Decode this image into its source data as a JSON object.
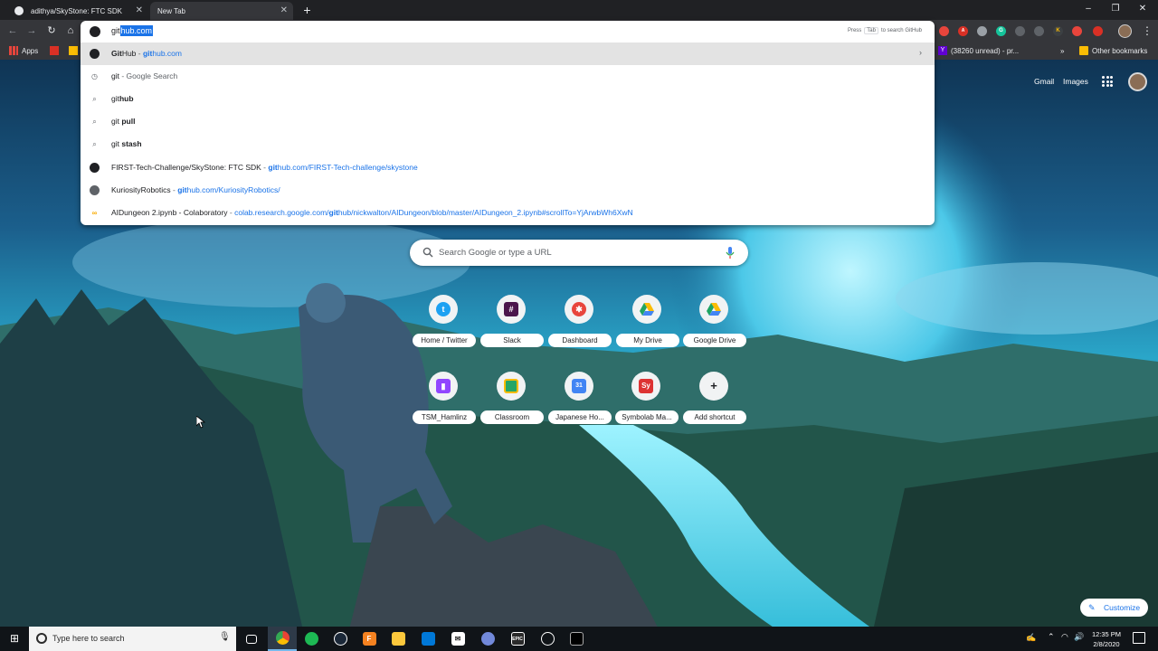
{
  "browser": {
    "tabs": [
      {
        "title": "adithya/SkyStone: FTC SDK",
        "active": false
      },
      {
        "title": "New Tab",
        "active": true
      }
    ],
    "window_controls": [
      "minimize",
      "restore",
      "close"
    ]
  },
  "toolbar": {
    "icons": [
      "back-icon",
      "forward-icon",
      "reload-icon",
      "home-icon"
    ]
  },
  "omnibox": {
    "typed": "git",
    "autocomplete_selected": "hub.com",
    "hint_press": "Press",
    "hint_key": "Tab",
    "hint_after": "to search GitHub",
    "suggestions": [
      {
        "icon": "github-icon",
        "bold": "Git",
        "rest": "Hub",
        "sep": " - ",
        "url_bold": "git",
        "url_rest": "hub.com",
        "active": true
      },
      {
        "icon": "history-icon",
        "bold": "",
        "rest": "git",
        "sep": " - ",
        "dim": "Google Search"
      },
      {
        "icon": "search-icon",
        "bold": "hub",
        "prefix": "git"
      },
      {
        "icon": "search-icon",
        "bold": " pull",
        "prefix": "git"
      },
      {
        "icon": "search-icon",
        "bold": " stash",
        "prefix": "git"
      },
      {
        "icon": "github-icon",
        "title": "FIRST-Tech-Challenge/SkyStone: FTC SDK",
        "sep": " - ",
        "url_bold": "git",
        "url_rest": "hub.com/FIRST-Tech-challenge/skystone"
      },
      {
        "icon": "globe-icon",
        "title": "KuriosityRobotics",
        "sep": " - ",
        "url_bold": "git",
        "url_rest": "hub.com/KuriosityRobotics/"
      },
      {
        "icon": "colab-icon",
        "title": "AIDungeon 2.ipynb - Colaboratory",
        "sep": " - ",
        "url_pre": "colab.research.google.com/",
        "url_bold": "git",
        "url_rest": "hub/nickwalton/AIDungeon/blob/master/AIDungeon_2.ipynb#scrollTo=YjArwbWh6XwN"
      }
    ]
  },
  "bookmarks_bar": {
    "apps": "Apps",
    "yahoo_mail": "(38260 unread) - pr...",
    "more": "»",
    "other": "Other bookmarks"
  },
  "google_header": {
    "gmail": "Gmail",
    "images": "Images"
  },
  "search": {
    "placeholder": "Search Google or type a URL"
  },
  "shortcuts": [
    {
      "label": "Home / Twitter",
      "icon": "twitter-icon",
      "color": "#1da1f2"
    },
    {
      "label": "Slack",
      "icon": "slack-icon",
      "color": "#4a154b"
    },
    {
      "label": "Dashboard",
      "icon": "dashboard-icon",
      "color": "#e8453c"
    },
    {
      "label": "My Drive",
      "icon": "drive-icon",
      "color": "#1fa463"
    },
    {
      "label": "Google Drive",
      "icon": "drive-icon",
      "color": "#1fa463"
    },
    {
      "label": "TSM_Hamlinz",
      "icon": "twitch-icon",
      "color": "#9146ff"
    },
    {
      "label": "Classroom",
      "icon": "classroom-icon",
      "color": "#25a667"
    },
    {
      "label": "Japanese Ho...",
      "icon": "calendar-icon",
      "color": "#4285f4"
    },
    {
      "label": "Symbolab Ma...",
      "icon": "symbolab-icon",
      "color": "#dd3333"
    },
    {
      "label": "Add shortcut",
      "icon": "plus-icon",
      "color": "#202124"
    }
  ],
  "customize": "Customize",
  "taskbar": {
    "search_placeholder": "Type here to search",
    "apps": [
      "task-view-icon",
      "chrome-icon",
      "spotify-icon",
      "steam-icon",
      "foxit-icon",
      "explorer-icon",
      "store-icon",
      "mail-icon",
      "discord-icon",
      "epic-games-icon",
      "clock-app-icon",
      "terminal-icon"
    ],
    "time": "12:35 PM",
    "date": "2/8/2020"
  }
}
